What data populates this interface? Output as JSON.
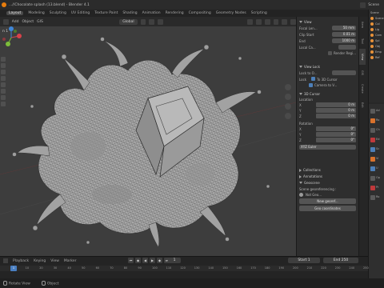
{
  "window": {
    "title": "...//Chocolate splash (13.blend) - Blender 4.1",
    "scene_label": "Scene"
  },
  "workspaces": [
    "Layout",
    "Modeling",
    "Sculpting",
    "UV Editing",
    "Texture Paint",
    "Shading",
    "Animation",
    "Rendering",
    "Compositing",
    "Geometry Nodes",
    "Scripting"
  ],
  "viewport_header": {
    "menus": [
      "Add",
      "Object",
      "GIS"
    ],
    "orientation": "Global",
    "viewport_title": "n 1"
  },
  "n_panel": {
    "view": {
      "header": "View",
      "focal_length_label": "Focal Len...",
      "focal_length_value": "50 mm",
      "clip_start_label": "Clip Start",
      "clip_start_value": "0.01 m",
      "clip_end_label": "End",
      "clip_end_value": "1000 m",
      "local_camera_label": "Local Ca...",
      "render_region_label": "Render Regi..."
    },
    "view_lock": {
      "header": "View Lock",
      "lock_to_object_label": "Lock to O...",
      "lock_label": "Lock",
      "to_3d_cursor_label": "To 3D Cursor",
      "camera_to_view_label": "Camera to V..."
    },
    "cursor": {
      "header": "3D Cursor",
      "location_label": "Location",
      "location": [
        {
          "axis": "X",
          "value": "0 m"
        },
        {
          "axis": "Y",
          "value": "0 m"
        },
        {
          "axis": "Z",
          "value": "0 m"
        }
      ],
      "rotation_label": "Rotation",
      "rotation": [
        {
          "axis": "X",
          "value": "0°"
        },
        {
          "axis": "Y",
          "value": "0°"
        },
        {
          "axis": "Z",
          "value": "0°"
        }
      ],
      "mode_value": "XYZ Euler"
    },
    "collections_label": "Collections",
    "annotations_label": "Annotations",
    "geoscene_label": "Geoscene",
    "scene_georef_label": "Scene georeferencing :",
    "not_geo_label": "Not Geo...",
    "georef_button": "New georef...",
    "geo_coords_button": "Geo coordinates"
  },
  "sidebar_tabs": [
    "Item",
    "Tool",
    "View",
    "GIS",
    "Create",
    "Edit"
  ],
  "outliner": {
    "header": "Scene",
    "rows": [
      "Scene",
      "Col",
      "Lig",
      "Cam",
      "Spl",
      "Obj",
      "Emp",
      "Ref"
    ]
  },
  "properties": {
    "rows": [
      "Ad",
      "Ro",
      "Ch",
      "Ed",
      "Sc",
      "Vi",
      "U",
      "Op",
      "Pr",
      "Ro"
    ]
  },
  "timeline": {
    "menus": [
      "Playback",
      "Keying",
      "View",
      "Marker"
    ],
    "current_frame": "1",
    "start_label": "Start",
    "start_value": "1",
    "end_label": "End",
    "end_value": "250",
    "ticks": [
      "1",
      "10",
      "20",
      "30",
      "40",
      "50",
      "60",
      "70",
      "80",
      "90",
      "100",
      "110",
      "120",
      "130",
      "140",
      "150",
      "160",
      "170",
      "180",
      "190",
      "200",
      "210",
      "220",
      "230",
      "240",
      "250"
    ]
  },
  "statusbar": {
    "left": "Rotate View",
    "middle": "Object"
  },
  "colors": {
    "accent_blue": "#4d7fb8",
    "blender_orange": "#e87d0d",
    "x_axis": "#d9424a",
    "y_axis": "#7dbe3a",
    "z_axis": "#3f86d8"
  }
}
